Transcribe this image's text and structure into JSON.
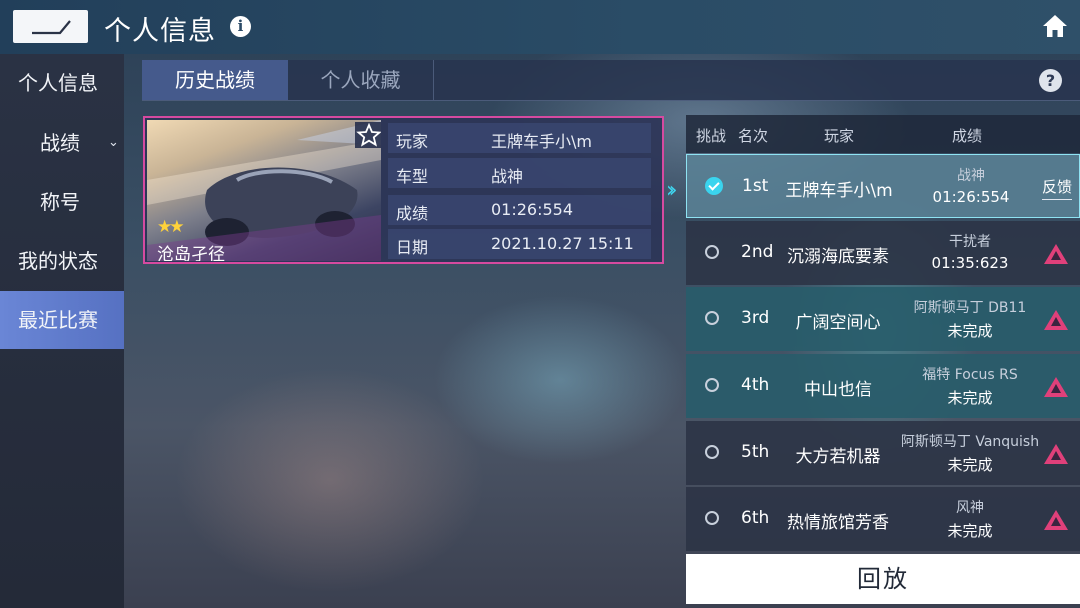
{
  "header": {
    "title": "个人信息",
    "back_icon": "back-arrow-icon",
    "info_icon": "info-icon",
    "home_icon": "home-icon"
  },
  "sidebar": {
    "items": [
      {
        "label": "个人信息"
      },
      {
        "label": "战绩"
      },
      {
        "label": "称号"
      },
      {
        "label": "我的状态"
      },
      {
        "label": "最近比赛",
        "active": true
      }
    ],
    "accent": "#5b77c9"
  },
  "tabs": [
    {
      "label": "历史战绩",
      "active": true
    },
    {
      "label": "个人收藏",
      "active": false
    }
  ],
  "record": {
    "track_name": "沧岛孑径",
    "stars": 2,
    "rows": [
      {
        "key": "玩家",
        "value": "王牌车手小\\m"
      },
      {
        "key": "车型",
        "value": "战神"
      },
      {
        "key": "成绩",
        "value": "01:26:554"
      },
      {
        "key": "日期",
        "value": "2021.10.27 15:11"
      }
    ]
  },
  "ranking": {
    "headers": [
      "挑战",
      "名次",
      "玩家",
      "成绩"
    ],
    "rows": [
      {
        "place": "1st",
        "player": "王牌车手小\\m",
        "car": "战神",
        "result": "01:26:554",
        "selected": true,
        "action": "反馈"
      },
      {
        "place": "2nd",
        "player": "沉溺海底要素",
        "car": "干扰者",
        "result": "01:35:623",
        "selected": false
      },
      {
        "place": "3rd",
        "player": "广阔空间心",
        "car": "阿斯顿马丁 DB11",
        "result": "未完成",
        "selected": false
      },
      {
        "place": "4th",
        "player": "中山也信",
        "car": "福特 Focus RS",
        "result": "未完成",
        "selected": false
      },
      {
        "place": "5th",
        "player": "大方若机器",
        "car": "阿斯顿马丁 Vanquish",
        "result": "未完成",
        "selected": false
      },
      {
        "place": "6th",
        "player": "热情旅馆芳香",
        "car": "风神",
        "result": "未完成",
        "selected": false
      }
    ],
    "challenge_icon_color": "#e0407a",
    "highlight_color": "#3ad4ee"
  },
  "replay_label": "回放"
}
